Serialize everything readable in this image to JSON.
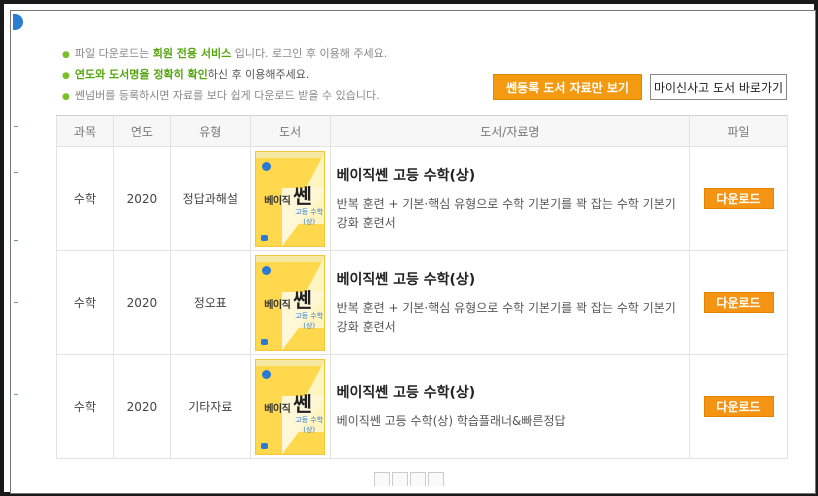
{
  "notices": [
    {
      "pre": "파일 다운로드는 ",
      "highlight": "회원 전용 서비스",
      "post": " 입니다. 로그인 후 이용해 주세요."
    },
    {
      "pre": "",
      "highlight": "연도와 도서명을 정확히 확인",
      "post": "하신 후 이용해주세요."
    },
    {
      "pre": "쎈넘버를 등록하시면 자료를 보다 쉽게 다운로드 받을 수 있습니다.",
      "highlight": "",
      "post": ""
    }
  ],
  "buttons": {
    "registered_only": "쎈등록 도서 자료만 보기",
    "my_shortcut": "마이신사고 도서 바로가기"
  },
  "table": {
    "headers": [
      "과목",
      "연도",
      "유형",
      "도서",
      "도서/자료명",
      "파일"
    ],
    "rows": [
      {
        "subject": "수학",
        "year": "2020",
        "type": "정답과해설",
        "cover": {
          "title": "베이직",
          "brand": "쎈",
          "sub": "고등 수학(상)"
        },
        "title": "베이직쎈 고등 수학(상)",
        "desc": "반복 훈련 + 기본·핵심 유형으로 수학 기본기를 꽉 잡는 수학 기본기 강화 훈련서",
        "download": "다운로드"
      },
      {
        "subject": "수학",
        "year": "2020",
        "type": "정오표",
        "cover": {
          "title": "베이직",
          "brand": "쎈",
          "sub": "고등 수학(상)"
        },
        "title": "베이직쎈 고등 수학(상)",
        "desc": "반복 훈련 + 기본·핵심 유형으로 수학 기본기를 꽉 잡는 수학 기본기 강화 훈련서",
        "download": "다운로드"
      },
      {
        "subject": "수학",
        "year": "2020",
        "type": "기타자료",
        "cover": {
          "title": "베이직",
          "brand": "쎈",
          "sub": "고등 수학(상)"
        },
        "title": "베이직쎈 고등 수학(상)",
        "desc": "베이직쎈 고등 수학(상) 학습플래너&빠른정답",
        "download": "다운로드"
      }
    ]
  },
  "colors": {
    "accent_orange": "#f59412",
    "notice_green": "#56a50e"
  }
}
